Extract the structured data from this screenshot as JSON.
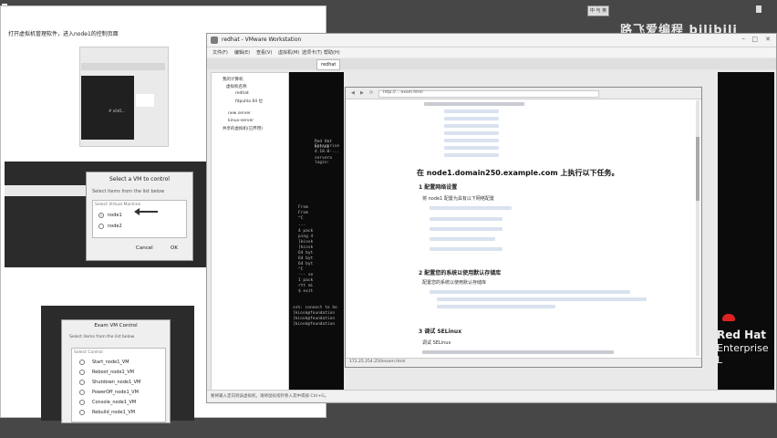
{
  "overlay": {
    "watermark": "路飞爱编程 bilibili",
    "clock": "中 与 英"
  },
  "left_panel": {
    "caption": "打开虚拟机管理软件，进入node1的控制页面",
    "mini_text": "# n0d1...",
    "select_dialog": {
      "title": "Select a VM to control",
      "hint": "Select items from the list below",
      "header": "Select   Virtual Machine",
      "options": [
        "node1",
        "node2"
      ],
      "cancel": "Cancel",
      "ok": "OK"
    },
    "exam_dialog": {
      "title": "Exam VM Control",
      "hint": "Select items from the list below",
      "header": "Select   Control",
      "options": [
        "Start_node1_VM",
        "Reboot_node1_VM",
        "Shutdown_node1_VM",
        "PowerOff_node1_VM",
        "Console_node1_VM",
        "Rebuild_node1_VM"
      ]
    }
  },
  "vmware": {
    "title": "redhat - VMware Workstation",
    "menu": [
      "文件(F)",
      "编辑(E)",
      "查看(V)",
      "虚拟机(M)",
      "选项卡(T)",
      "帮助(H)"
    ],
    "tab": "redhat",
    "library": [
      "我的计算机",
      "虚拟机名称",
      "redhat",
      "fdpuhla 64 位",
      "new server",
      "kinux-server",
      "共享的虚拟机(已弃用)"
    ],
    "terminal_lines": [
      "Red Hat Enterprise",
      "Kernel 4.18.0-...",
      "",
      "servera login:",
      "From",
      "From",
      "^C",
      "---",
      "4 pack",
      "ping 4",
      "[kiosk",
      "[kiosk",
      "64 byt",
      "64 byt",
      "64 byt",
      "^C",
      "--- se",
      "1 pack",
      "rtt mi",
      "$ exit",
      "ssh: connect to ho",
      "[kiosk@foundation",
      "[kiosk@foundation",
      "[kiosk@foundation"
    ],
    "status": "要将输入定向到该虚拟机，请将鼠标指针移入其中或按 Ctrl+G。"
  },
  "document": {
    "url": "http://... exam.html",
    "main_heading": "在 node1.domain250.example.com 上执行以下任务。",
    "sections": [
      {
        "title": "1 配置网络设置",
        "lead": "将 node1 配置为具有以下网络配置"
      },
      {
        "title": "2 配置您的系统以使用默认存储库",
        "lead": "配置您的系统以使用默认存储库"
      },
      {
        "title": "3 调试 SELinux",
        "lead": "调试 SELinux"
      }
    ],
    "status_text": "172.25.254.250/exam.html"
  },
  "brand": {
    "line1": "Red Hat",
    "line2": "Enterprise L"
  }
}
